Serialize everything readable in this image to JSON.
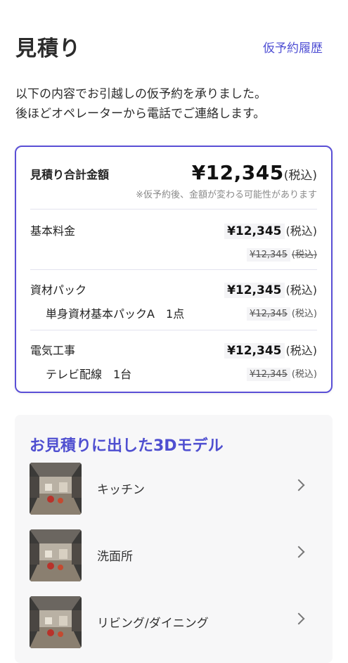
{
  "header": {
    "title": "見積り",
    "history_link": "仮予約履歴"
  },
  "intro": {
    "line1": "以下の内容でお引越しの仮予約を承りました。",
    "line2": "後ほどオペレーターから電話でご連絡します。"
  },
  "estimate": {
    "total_label": "見積り合計金額",
    "total_value": "¥12,345",
    "total_tax": "(税込)",
    "total_note": "※仮予約後、金額が変わる可能性があります",
    "items": [
      {
        "label": "基本料金",
        "sub": "",
        "price": "¥12,345",
        "price_tax": "(税込)",
        "old_price": "¥12,345",
        "old_tax": "(税込)"
      },
      {
        "label": "資材パック",
        "sub": "単身資材基本パックA　1点",
        "price": "¥12,345",
        "price_tax": "(税込)",
        "old_price": "¥12,345",
        "old_tax": "(税込)"
      },
      {
        "label": "電気工事",
        "sub": "テレビ配線　1台",
        "price": "¥12,345",
        "price_tax": "(税込)",
        "old_price": "¥12,345",
        "old_tax": "(税込)"
      }
    ]
  },
  "models": {
    "title": "お見積りに出した3Dモデル",
    "items": [
      {
        "label": "キッチン"
      },
      {
        "label": "洗面所"
      },
      {
        "label": "リビング/ダイニング"
      }
    ]
  },
  "colors": {
    "accent": "#5050d4",
    "card_border": "#5a4fd6",
    "section_bg": "#f7f7f8"
  }
}
